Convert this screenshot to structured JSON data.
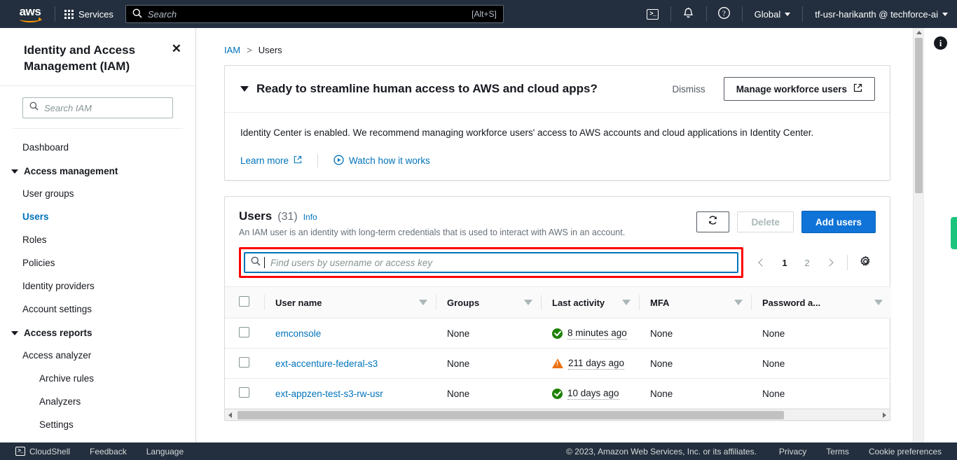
{
  "topnav": {
    "logo_text": "aws",
    "services_label": "Services",
    "search_placeholder": "Search",
    "search_shortcut": "[Alt+S]",
    "cloudshell_icon": "terminal-icon",
    "bell_icon": "notifications-bell-icon",
    "help_icon": "help-question-icon",
    "region_label": "Global",
    "account_label": "tf-usr-harikanth @ techforce-ai"
  },
  "sidebar": {
    "title": "Identity and Access Management (IAM)",
    "close_icon": "close-icon",
    "search_placeholder": "Search IAM",
    "items": [
      {
        "label": "Dashboard",
        "type": "item",
        "active": false
      },
      {
        "label": "Access management",
        "type": "group"
      },
      {
        "label": "User groups",
        "type": "item",
        "active": false
      },
      {
        "label": "Users",
        "type": "item",
        "active": true
      },
      {
        "label": "Roles",
        "type": "item",
        "active": false
      },
      {
        "label": "Policies",
        "type": "item",
        "active": false
      },
      {
        "label": "Identity providers",
        "type": "item",
        "active": false
      },
      {
        "label": "Account settings",
        "type": "item",
        "active": false
      },
      {
        "label": "Access reports",
        "type": "group"
      },
      {
        "label": "Access analyzer",
        "type": "item",
        "active": false
      },
      {
        "label": "Archive rules",
        "type": "sub",
        "active": false
      },
      {
        "label": "Analyzers",
        "type": "sub",
        "active": false
      },
      {
        "label": "Settings",
        "type": "sub",
        "active": false
      }
    ]
  },
  "breadcrumb": {
    "root": "IAM",
    "separator": ">",
    "current": "Users"
  },
  "banner": {
    "title": "Ready to streamline human access to AWS and cloud apps?",
    "dismiss_label": "Dismiss",
    "cta_label": "Manage workforce users",
    "cta_icon": "external-link-icon",
    "body": "Identity Center is enabled. We recommend managing workforce users' access to AWS accounts and cloud applications in Identity Center.",
    "learn_more_label": "Learn more",
    "learn_more_icon": "external-link-icon",
    "watch_label": "Watch how it works",
    "watch_icon": "play-circle-icon",
    "collapse_icon": "triangle-down-icon"
  },
  "users_panel": {
    "title": "Users",
    "count": "(31)",
    "info_label": "Info",
    "description": "An IAM user is an identity with long-term credentials that is used to interact with AWS in an account.",
    "refresh_icon": "refresh-icon",
    "delete_label": "Delete",
    "add_users_label": "Add users",
    "search_placeholder": "Find users by username or access key",
    "search_icon": "search-icon",
    "settings_icon": "gear-icon",
    "prev_icon": "chevron-left-icon",
    "next_icon": "chevron-right-icon",
    "pages": [
      "1",
      "2"
    ],
    "current_page": "1",
    "highlight_color": "#ff0000",
    "focus_color": "#0073bb",
    "columns": [
      "User name",
      "Groups",
      "Last activity",
      "MFA",
      "Password a..."
    ],
    "rows": [
      {
        "user_name": "emconsole",
        "groups": "None",
        "last_activity": "8 minutes ago",
        "activity_status": "ok",
        "mfa": "None",
        "password_age": "None"
      },
      {
        "user_name": "ext-accenture-federal-s3",
        "groups": "None",
        "last_activity": "211 days ago",
        "activity_status": "warn",
        "mfa": "None",
        "password_age": "None"
      },
      {
        "user_name": "ext-appzen-test-s3-rw-usr",
        "groups": "None",
        "last_activity": "10 days ago",
        "activity_status": "ok",
        "mfa": "None",
        "password_age": "None"
      }
    ]
  },
  "rail": {
    "info_icon": "info-circle-icon",
    "feedback_tab": "feedback-tab"
  },
  "footer": {
    "cloudshell_label": "CloudShell",
    "cloudshell_icon": "terminal-icon",
    "feedback_label": "Feedback",
    "language_label": "Language",
    "copyright": "© 2023, Amazon Web Services, Inc. or its affiliates.",
    "privacy_label": "Privacy",
    "terms_label": "Terms",
    "cookie_label": "Cookie preferences"
  }
}
